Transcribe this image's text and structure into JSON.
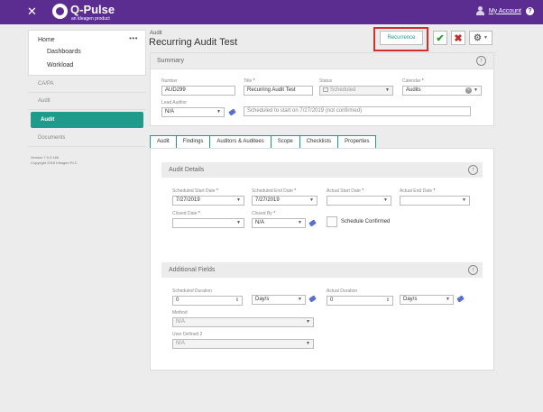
{
  "topbar": {
    "close_glyph": "✕",
    "logo_name": "Q-Pulse",
    "logo_tag": "an ideagen product",
    "account_label": "My Account",
    "help_glyph": "?",
    "icons": [
      "close-icon",
      "user-icon",
      "help-icon"
    ]
  },
  "sidebar": {
    "home": "Home",
    "more": "•••",
    "sub_items": [
      "Dashboards",
      "Workload"
    ],
    "items": [
      {
        "label": "CA/PA",
        "active": false
      },
      {
        "label": "Audit",
        "active": false
      },
      {
        "label": "Audit",
        "active": true
      },
      {
        "label": "Documents",
        "active": false
      }
    ],
    "version": "Version 7.0.0.166",
    "copyright": "Copyright 2018 Ideagen PLC"
  },
  "header": {
    "breadcrumb": "Audit",
    "title": "Recurring Audit Test",
    "recurrence_label": "Recurrence",
    "save_glyph": "✔",
    "cancel_glyph": "✖",
    "gear_glyph": "⚙",
    "colors": {
      "accent": "#1e9b8a",
      "brand": "#5c2d91",
      "highlight": "#d62d2d"
    }
  },
  "summary": {
    "title": "Summary",
    "collapse_glyph": "↑",
    "number": {
      "label": "Number",
      "value": "AUD299"
    },
    "title_field": {
      "label": "Title",
      "value": "Recurring Audit Test"
    },
    "status": {
      "label": "Status",
      "value": "Scheduled"
    },
    "calendar": {
      "label": "Calendar",
      "value": "Audits"
    },
    "lead_auditor": {
      "label": "Lead Auditor",
      "value": "N/A"
    },
    "schedule_note": "Scheduled to start on 7/27/2019 (not confirmed)"
  },
  "tabs": [
    {
      "label": "Audit",
      "active": true
    },
    {
      "label": "Findings",
      "active": false
    },
    {
      "label": "Auditors & Auditees",
      "active": false
    },
    {
      "label": "Scope",
      "active": false
    },
    {
      "label": "Checklists",
      "active": false
    },
    {
      "label": "Properties",
      "active": false
    }
  ],
  "audit_details": {
    "title": "Audit Details",
    "scheduled_start": {
      "label": "Scheduled Start Date",
      "value": "7/27/2019"
    },
    "scheduled_end": {
      "label": "Scheduled End Date",
      "value": "7/27/2019"
    },
    "actual_start": {
      "label": "Actual Start Date",
      "value": ""
    },
    "actual_end": {
      "label": "Actual End Date",
      "value": ""
    },
    "closed_date": {
      "label": "Closed Date",
      "value": ""
    },
    "closed_by": {
      "label": "Closed By",
      "value": "N/A"
    },
    "schedule_confirmed": {
      "label": "Schedule Confirmed",
      "checked": false
    }
  },
  "additional_fields": {
    "title": "Additional Fields",
    "scheduled_duration": {
      "label": "Scheduled Duration",
      "value": "0",
      "unit": "Day/s"
    },
    "actual_duration": {
      "label": "Actual Duration",
      "value": "0",
      "unit": "Day/s"
    },
    "method": {
      "label": "Method",
      "value": "N/A"
    },
    "user_defined_2": {
      "label": "User Defined 2",
      "value": "N/A"
    }
  }
}
